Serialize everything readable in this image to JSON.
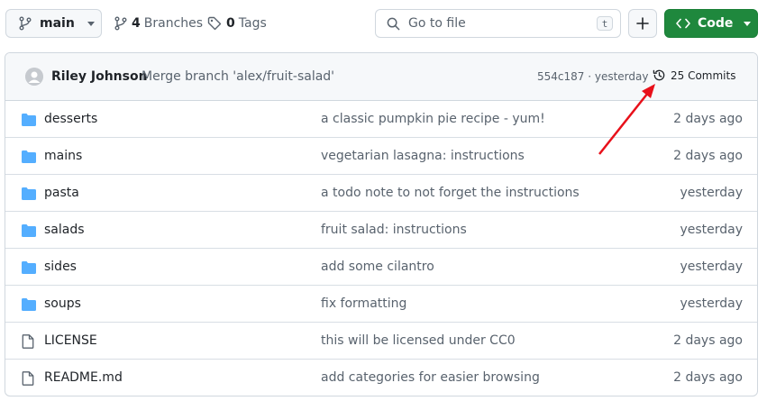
{
  "toolbar": {
    "branch": "main",
    "branches_count": "4",
    "branches_label": "Branches",
    "tags_count": "0",
    "tags_label": "Tags",
    "search_placeholder": "Go to file",
    "search_shortcut": "t",
    "code_label": "Code"
  },
  "latest_commit": {
    "author": "Riley Johnson",
    "message": "Merge branch 'alex/fruit-salad'",
    "hash_time": "554c187 · yesterday",
    "commits_label": "25 Commits"
  },
  "files": [
    {
      "name": "desserts",
      "type": "folder",
      "message": "a classic pumpkin pie recipe - yum!",
      "date": "2 days ago"
    },
    {
      "name": "mains",
      "type": "folder",
      "message": "vegetarian lasagna: instructions",
      "date": "2 days ago"
    },
    {
      "name": "pasta",
      "type": "folder",
      "message": "a todo note to not forget the instructions",
      "date": "yesterday"
    },
    {
      "name": "salads",
      "type": "folder",
      "message": "fruit salad: instructions",
      "date": "yesterday"
    },
    {
      "name": "sides",
      "type": "folder",
      "message": "add some cilantro",
      "date": "yesterday"
    },
    {
      "name": "soups",
      "type": "folder",
      "message": "fix formatting",
      "date": "yesterday"
    },
    {
      "name": "LICENSE",
      "type": "file",
      "message": "this will be licensed under CC0",
      "date": "2 days ago"
    },
    {
      "name": "README.md",
      "type": "file",
      "message": "add categories for easier browsing",
      "date": "2 days ago"
    }
  ],
  "colors": {
    "folder": "#54aeff",
    "accent_green": "#1f883d",
    "annotation_arrow": "#e8101a"
  },
  "icons": {
    "branch": "git-branch-icon",
    "tag": "tag-icon",
    "search": "search-icon",
    "plus": "plus-icon",
    "code": "code-icon",
    "history": "history-icon",
    "folder": "folder-icon",
    "file": "file-icon"
  }
}
